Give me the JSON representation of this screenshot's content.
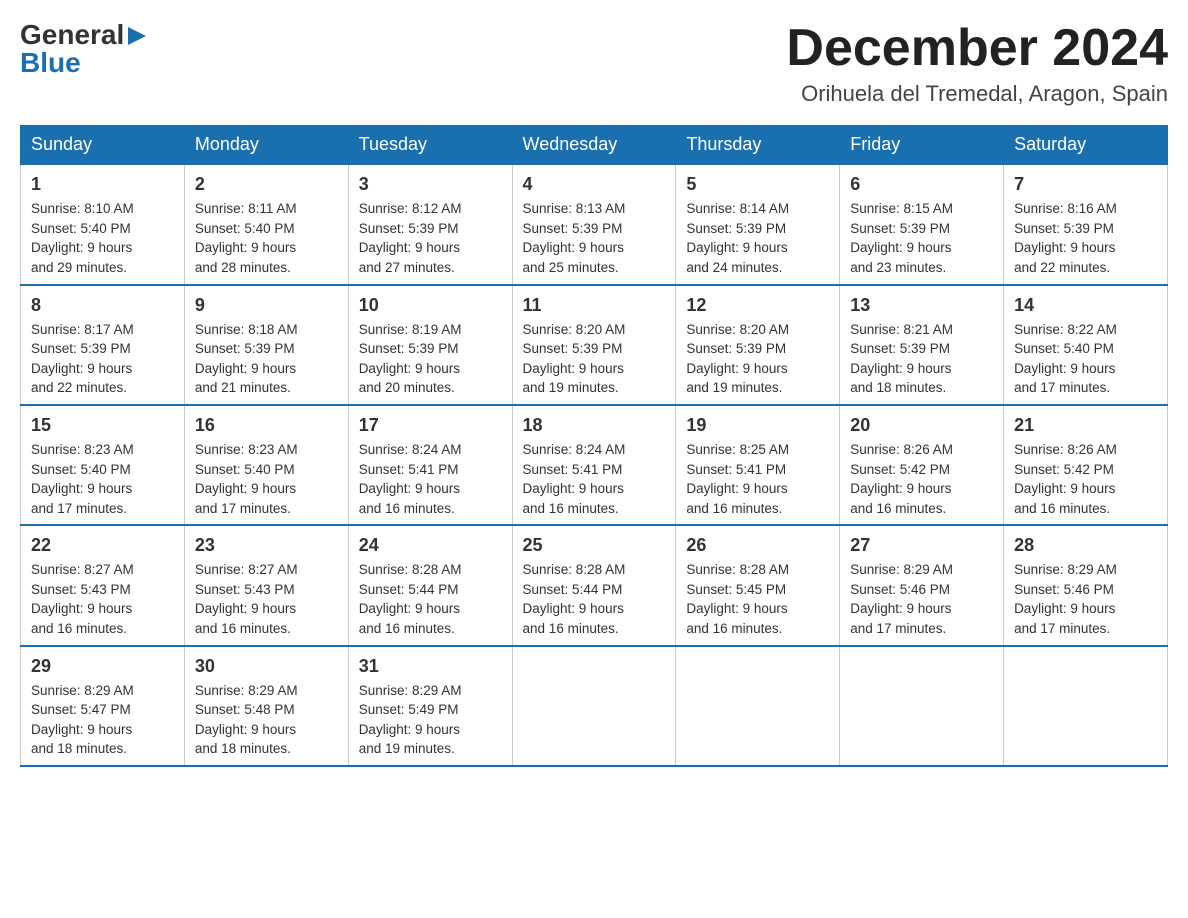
{
  "header": {
    "logo_line1": "General",
    "logo_line2": "Blue",
    "month_title": "December 2024",
    "location": "Orihuela del Tremedal, Aragon, Spain"
  },
  "weekdays": [
    "Sunday",
    "Monday",
    "Tuesday",
    "Wednesday",
    "Thursday",
    "Friday",
    "Saturday"
  ],
  "weeks": [
    [
      {
        "day": "1",
        "sunrise": "8:10 AM",
        "sunset": "5:40 PM",
        "daylight": "9 hours and 29 minutes."
      },
      {
        "day": "2",
        "sunrise": "8:11 AM",
        "sunset": "5:40 PM",
        "daylight": "9 hours and 28 minutes."
      },
      {
        "day": "3",
        "sunrise": "8:12 AM",
        "sunset": "5:39 PM",
        "daylight": "9 hours and 27 minutes."
      },
      {
        "day": "4",
        "sunrise": "8:13 AM",
        "sunset": "5:39 PM",
        "daylight": "9 hours and 25 minutes."
      },
      {
        "day": "5",
        "sunrise": "8:14 AM",
        "sunset": "5:39 PM",
        "daylight": "9 hours and 24 minutes."
      },
      {
        "day": "6",
        "sunrise": "8:15 AM",
        "sunset": "5:39 PM",
        "daylight": "9 hours and 23 minutes."
      },
      {
        "day": "7",
        "sunrise": "8:16 AM",
        "sunset": "5:39 PM",
        "daylight": "9 hours and 22 minutes."
      }
    ],
    [
      {
        "day": "8",
        "sunrise": "8:17 AM",
        "sunset": "5:39 PM",
        "daylight": "9 hours and 22 minutes."
      },
      {
        "day": "9",
        "sunrise": "8:18 AM",
        "sunset": "5:39 PM",
        "daylight": "9 hours and 21 minutes."
      },
      {
        "day": "10",
        "sunrise": "8:19 AM",
        "sunset": "5:39 PM",
        "daylight": "9 hours and 20 minutes."
      },
      {
        "day": "11",
        "sunrise": "8:20 AM",
        "sunset": "5:39 PM",
        "daylight": "9 hours and 19 minutes."
      },
      {
        "day": "12",
        "sunrise": "8:20 AM",
        "sunset": "5:39 PM",
        "daylight": "9 hours and 19 minutes."
      },
      {
        "day": "13",
        "sunrise": "8:21 AM",
        "sunset": "5:39 PM",
        "daylight": "9 hours and 18 minutes."
      },
      {
        "day": "14",
        "sunrise": "8:22 AM",
        "sunset": "5:40 PM",
        "daylight": "9 hours and 17 minutes."
      }
    ],
    [
      {
        "day": "15",
        "sunrise": "8:23 AM",
        "sunset": "5:40 PM",
        "daylight": "9 hours and 17 minutes."
      },
      {
        "day": "16",
        "sunrise": "8:23 AM",
        "sunset": "5:40 PM",
        "daylight": "9 hours and 17 minutes."
      },
      {
        "day": "17",
        "sunrise": "8:24 AM",
        "sunset": "5:41 PM",
        "daylight": "9 hours and 16 minutes."
      },
      {
        "day": "18",
        "sunrise": "8:24 AM",
        "sunset": "5:41 PM",
        "daylight": "9 hours and 16 minutes."
      },
      {
        "day": "19",
        "sunrise": "8:25 AM",
        "sunset": "5:41 PM",
        "daylight": "9 hours and 16 minutes."
      },
      {
        "day": "20",
        "sunrise": "8:26 AM",
        "sunset": "5:42 PM",
        "daylight": "9 hours and 16 minutes."
      },
      {
        "day": "21",
        "sunrise": "8:26 AM",
        "sunset": "5:42 PM",
        "daylight": "9 hours and 16 minutes."
      }
    ],
    [
      {
        "day": "22",
        "sunrise": "8:27 AM",
        "sunset": "5:43 PM",
        "daylight": "9 hours and 16 minutes."
      },
      {
        "day": "23",
        "sunrise": "8:27 AM",
        "sunset": "5:43 PM",
        "daylight": "9 hours and 16 minutes."
      },
      {
        "day": "24",
        "sunrise": "8:28 AM",
        "sunset": "5:44 PM",
        "daylight": "9 hours and 16 minutes."
      },
      {
        "day": "25",
        "sunrise": "8:28 AM",
        "sunset": "5:44 PM",
        "daylight": "9 hours and 16 minutes."
      },
      {
        "day": "26",
        "sunrise": "8:28 AM",
        "sunset": "5:45 PM",
        "daylight": "9 hours and 16 minutes."
      },
      {
        "day": "27",
        "sunrise": "8:29 AM",
        "sunset": "5:46 PM",
        "daylight": "9 hours and 17 minutes."
      },
      {
        "day": "28",
        "sunrise": "8:29 AM",
        "sunset": "5:46 PM",
        "daylight": "9 hours and 17 minutes."
      }
    ],
    [
      {
        "day": "29",
        "sunrise": "8:29 AM",
        "sunset": "5:47 PM",
        "daylight": "9 hours and 18 minutes."
      },
      {
        "day": "30",
        "sunrise": "8:29 AM",
        "sunset": "5:48 PM",
        "daylight": "9 hours and 18 minutes."
      },
      {
        "day": "31",
        "sunrise": "8:29 AM",
        "sunset": "5:49 PM",
        "daylight": "9 hours and 19 minutes."
      },
      null,
      null,
      null,
      null
    ]
  ],
  "labels": {
    "sunrise": "Sunrise:",
    "sunset": "Sunset:",
    "daylight": "Daylight:"
  }
}
